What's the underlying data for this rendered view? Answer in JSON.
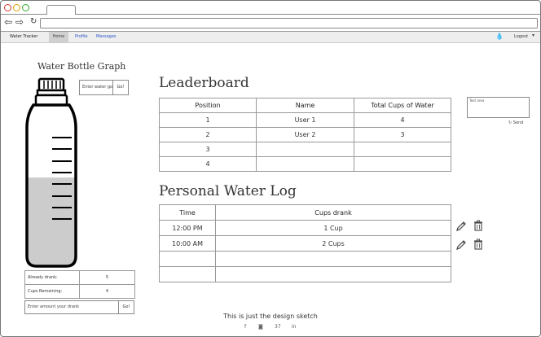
{
  "app": {
    "brand": "Water Tracker",
    "nav": {
      "home": "Home",
      "profile": "Profile",
      "messages": "Messages"
    },
    "logout": "Logout"
  },
  "bottle": {
    "title": "Water Bottle Graph",
    "goal_placeholder": "Enter water goal",
    "goal_button": "Go!",
    "fill_fraction": 0.55
  },
  "stats": {
    "already_drank_label": "Already drank:",
    "already_drank_value": "5",
    "cups_remaining_label": "Cups Remaining:",
    "cups_remaining_value": "4"
  },
  "drink_input": {
    "placeholder": "Enter amount your drank",
    "button": "Go!"
  },
  "leaderboard": {
    "title": "Leaderboard",
    "headers": [
      "Position",
      "Name",
      "Total Cups of Water"
    ],
    "rows": [
      [
        "1",
        "User 1",
        "4"
      ],
      [
        "2",
        "User 2",
        "3"
      ],
      [
        "3",
        "",
        ""
      ],
      [
        "4",
        "",
        ""
      ]
    ]
  },
  "chat": {
    "text_area": "Text area",
    "send": "Send"
  },
  "log": {
    "title": "Personal Water Log",
    "headers": [
      "Time",
      "Cups drank"
    ],
    "rows": [
      [
        "12:00 PM",
        "1 Cup"
      ],
      [
        "10:00 AM",
        "2 Cups"
      ],
      [
        "",
        ""
      ],
      [
        "",
        ""
      ]
    ]
  },
  "footer": {
    "note": "This is just the design sketch"
  }
}
